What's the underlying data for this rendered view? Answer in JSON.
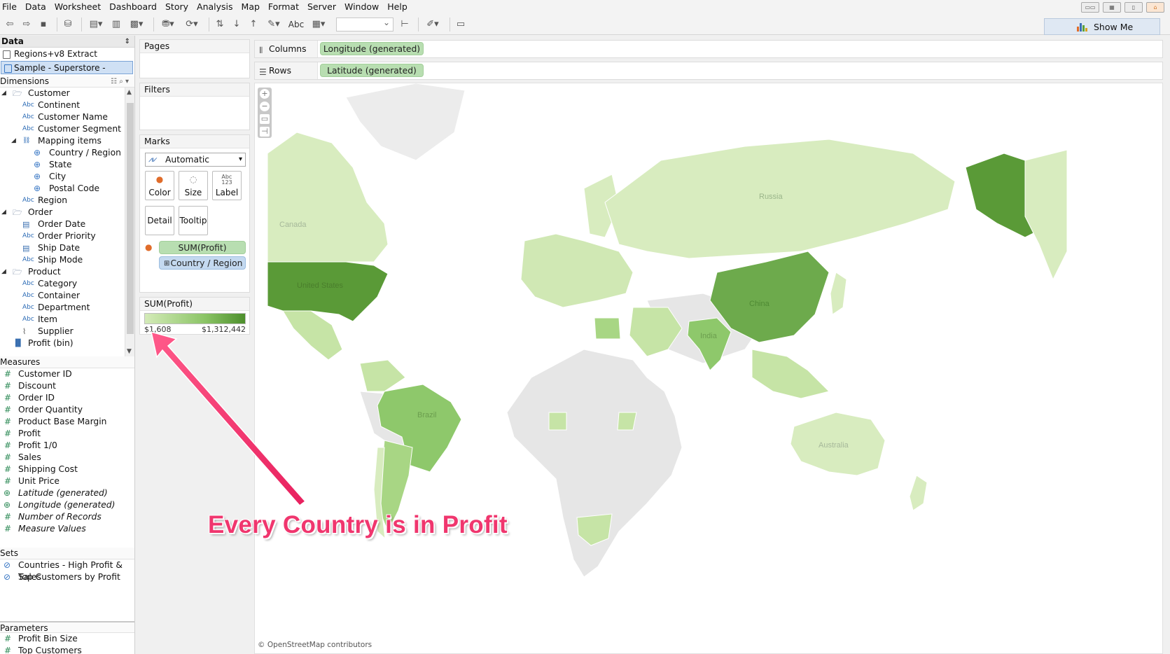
{
  "menu": [
    "File",
    "Data",
    "Worksheet",
    "Dashboard",
    "Story",
    "Analysis",
    "Map",
    "Format",
    "Server",
    "Window",
    "Help"
  ],
  "toolbar": {
    "abc_label": "Abc",
    "show_me": "Show Me"
  },
  "data_pane": {
    "header": "Data",
    "sources": [
      "Regions+v8 Extract",
      "Sample - Superstore - English..."
    ],
    "dimensions_header": "Dimensions",
    "dimensions": [
      {
        "label": "Customer",
        "type": "folder",
        "level": 0,
        "expanded": true
      },
      {
        "label": "Continent",
        "type": "abc",
        "level": 1
      },
      {
        "label": "Customer Name",
        "type": "abc",
        "level": 1
      },
      {
        "label": "Customer Segment",
        "type": "abc",
        "level": 1
      },
      {
        "label": "Mapping items",
        "type": "hierarchy",
        "level": 1,
        "expanded": true
      },
      {
        "label": "Country / Region",
        "type": "geo",
        "level": 2
      },
      {
        "label": "State",
        "type": "geo",
        "level": 2
      },
      {
        "label": "City",
        "type": "geo",
        "level": 2
      },
      {
        "label": "Postal Code",
        "type": "geo",
        "level": 2
      },
      {
        "label": "Region",
        "type": "abc",
        "level": 1
      },
      {
        "label": "Order",
        "type": "folder",
        "level": 0,
        "expanded": true
      },
      {
        "label": "Order Date",
        "type": "date",
        "level": 1
      },
      {
        "label": "Order Priority",
        "type": "abc",
        "level": 1
      },
      {
        "label": "Ship Date",
        "type": "date",
        "level": 1
      },
      {
        "label": "Ship Mode",
        "type": "abc",
        "level": 1
      },
      {
        "label": "Product",
        "type": "folder",
        "level": 0,
        "expanded": true
      },
      {
        "label": "Category",
        "type": "abc",
        "level": 1
      },
      {
        "label": "Container",
        "type": "abc",
        "level": 1
      },
      {
        "label": "Department",
        "type": "abc",
        "level": 1
      },
      {
        "label": "Item",
        "type": "abc",
        "level": 1
      },
      {
        "label": "Supplier",
        "type": "paperclip",
        "level": 1
      },
      {
        "label": "Profit (bin)",
        "type": "bin",
        "level": 0
      }
    ],
    "measures_header": "Measures",
    "measures": [
      {
        "label": "Customer ID",
        "italic": false,
        "icon": "hash"
      },
      {
        "label": "Discount",
        "italic": false,
        "icon": "hash"
      },
      {
        "label": "Order ID",
        "italic": false,
        "icon": "hash"
      },
      {
        "label": "Order Quantity",
        "italic": false,
        "icon": "hash"
      },
      {
        "label": "Product Base Margin",
        "italic": false,
        "icon": "hash"
      },
      {
        "label": "Profit",
        "italic": false,
        "icon": "hash"
      },
      {
        "label": "Profit 1/0",
        "italic": false,
        "icon": "hash"
      },
      {
        "label": "Sales",
        "italic": false,
        "icon": "hash"
      },
      {
        "label": "Shipping Cost",
        "italic": false,
        "icon": "hash"
      },
      {
        "label": "Unit Price",
        "italic": false,
        "icon": "hash"
      },
      {
        "label": "Latitude (generated)",
        "italic": true,
        "icon": "globe"
      },
      {
        "label": "Longitude (generated)",
        "italic": true,
        "icon": "globe"
      },
      {
        "label": "Number of Records",
        "italic": true,
        "icon": "hash"
      },
      {
        "label": "Measure Values",
        "italic": true,
        "icon": "hash"
      }
    ],
    "sets_header": "Sets",
    "sets": [
      "Countries - High Profit & Sales",
      "Top Customers by Profit"
    ],
    "parameters_header": "Parameters",
    "parameters": [
      "Profit Bin Size",
      "Top Customers"
    ]
  },
  "shelves": {
    "pages": "Pages",
    "filters": "Filters",
    "marks": "Marks",
    "mark_type": "Automatic",
    "mark_buttons": [
      "Color",
      "Size",
      "Label",
      "Detail",
      "Tooltip"
    ],
    "label_icon_text": "Abc\n123",
    "color_pill": "SUM(Profit)",
    "detail_pill": "Country / Region",
    "columns_label": "Columns",
    "columns_pill": "Longitude (generated)",
    "rows_label": "Rows",
    "rows_pill": "Latitude (generated)"
  },
  "legend": {
    "title": "SUM(Profit)",
    "min": "$1,608",
    "max": "$1,312,442"
  },
  "map": {
    "labels": [
      "Russia",
      "Canada",
      "United States",
      "China",
      "India",
      "Brazil",
      "Australia"
    ],
    "attribution": "© OpenStreetMap contributors",
    "colors": {
      "no_data": "#e6e6e6",
      "low": "#d8ecbf",
      "mid": "#9ed07c",
      "high": "#5a9a37",
      "water": "#ffffff"
    }
  },
  "annotation": "Every Country is in Profit"
}
